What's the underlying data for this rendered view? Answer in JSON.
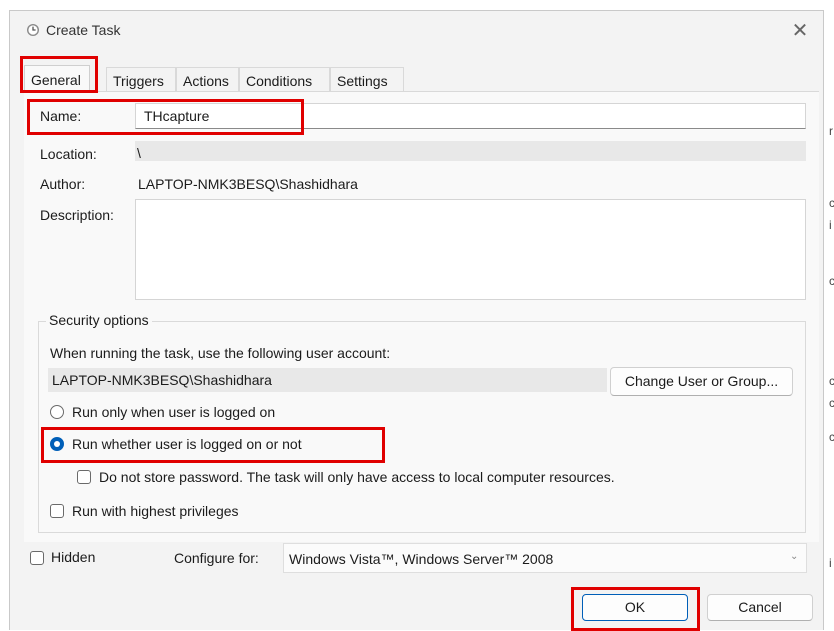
{
  "window": {
    "title": "Create Task",
    "close_glyph": "✕"
  },
  "tabs": [
    {
      "label": "General"
    },
    {
      "label": "Triggers"
    },
    {
      "label": "Actions"
    },
    {
      "label": "Conditions"
    },
    {
      "label": "Settings"
    }
  ],
  "general": {
    "name_label": "Name:",
    "name_value": "THcapture",
    "location_label": "Location:",
    "location_value": "\\",
    "author_label": "Author:",
    "author_value": "LAPTOP-NMK3BESQ\\Shashidhara",
    "description_label": "Description:",
    "description_value": ""
  },
  "security": {
    "legend": "Security options",
    "account_prompt": "When running the task, use the following user account:",
    "account_value": "LAPTOP-NMK3BESQ\\Shashidhara",
    "change_user_button": "Change User or Group...",
    "radio_logged_on": "Run only when user is logged on",
    "radio_whether": "Run whether user is logged on or not",
    "selected_option": "Run whether user is logged on or not",
    "no_store_password": "Do not store password.  The task will only have access to local computer resources.",
    "highest_privileges": "Run with highest privileges"
  },
  "footer": {
    "hidden_label": "Hidden",
    "configure_label": "Configure for:",
    "configure_value": "Windows Vista™, Windows Server™ 2008",
    "ok_label": "OK",
    "cancel_label": "Cancel"
  },
  "background_chars": [
    "r",
    "c",
    "i",
    "c",
    "c",
    "c",
    "c",
    "i"
  ],
  "colors": {
    "accent": "#005fb8",
    "highlight": "#e00000",
    "dialog_bg": "#f3f3f3"
  }
}
